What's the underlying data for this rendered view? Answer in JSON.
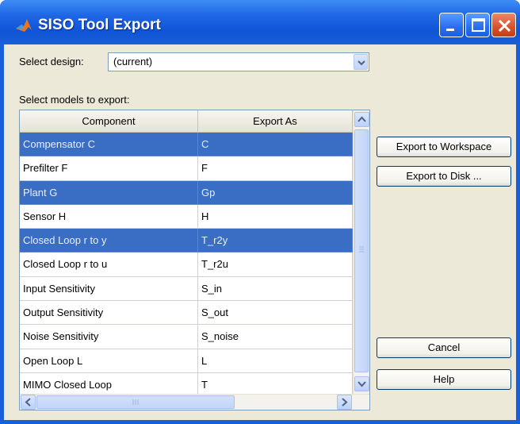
{
  "window": {
    "title": "SISO Tool Export"
  },
  "select_design": {
    "label": "Select design:",
    "value": "(current)"
  },
  "models_label": "Select models to export:",
  "table": {
    "headers": [
      "Component",
      "Export As"
    ],
    "rows": [
      {
        "component": "Compensator C",
        "export_as": "C",
        "selected": true
      },
      {
        "component": "Prefilter F",
        "export_as": "F",
        "selected": false
      },
      {
        "component": "Plant G",
        "export_as": "Gp",
        "selected": true
      },
      {
        "component": "Sensor H",
        "export_as": "H",
        "selected": false
      },
      {
        "component": "Closed Loop r to y",
        "export_as": "T_r2y",
        "selected": true
      },
      {
        "component": "Closed Loop r to u",
        "export_as": "T_r2u",
        "selected": false
      },
      {
        "component": "Input Sensitivity",
        "export_as": "S_in",
        "selected": false
      },
      {
        "component": "Output Sensitivity",
        "export_as": "S_out",
        "selected": false
      },
      {
        "component": "Noise Sensitivity",
        "export_as": "S_noise",
        "selected": false
      },
      {
        "component": "Open Loop L",
        "export_as": "L",
        "selected": false
      },
      {
        "component": "MIMO Closed Loop",
        "export_as": "T",
        "selected": false
      }
    ]
  },
  "buttons": {
    "export_workspace": "Export to Workspace",
    "export_disk": "Export to Disk ...",
    "cancel": "Cancel",
    "help": "Help"
  },
  "icons": {
    "app": "matlab-logo-icon",
    "minimize": "minimize-icon",
    "maximize": "maximize-icon",
    "close": "close-icon",
    "dropdown": "chevron-down-icon"
  },
  "colors": {
    "titlebar": "#1f66e4",
    "selection": "#3a6ec4",
    "dialog_bg": "#ece9d8"
  }
}
